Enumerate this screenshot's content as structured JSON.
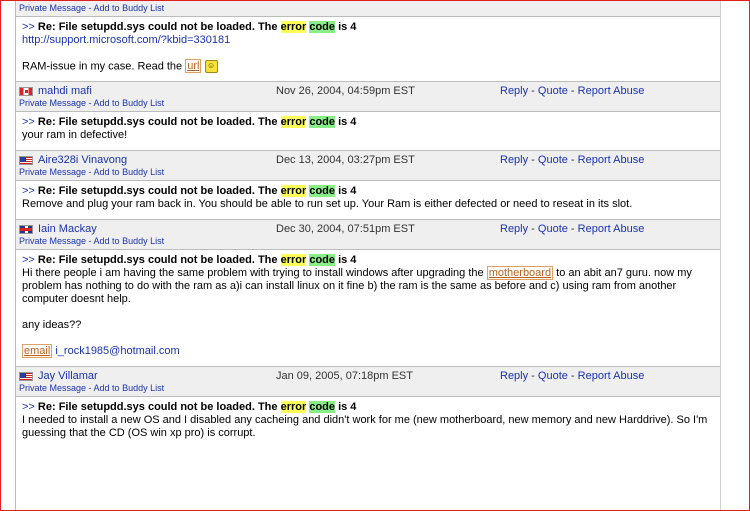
{
  "top_header": {
    "links": {
      "pm": "Private Message",
      "sep": " - ",
      "buddy": "Add to Buddy List"
    }
  },
  "posts": [
    {
      "has_header": false,
      "title_prefix": ">>",
      "title_lead": "Re: File setupdd.sys could not be loaded. The",
      "title_hl1": "error",
      "title_hl2": "code",
      "title_tail": "is 4",
      "link": "http://support.microsoft.com/?kbid=330181",
      "text_before_link": "RAM-issue in my case. Read the",
      "inline_link": "url",
      "smiley_icon": "smiley-icon"
    },
    {
      "author": "mahdi mafi",
      "flag": "canada-flag-icon",
      "date": "Nov 26, 2004, 04:59pm EST",
      "reply": "Reply",
      "quote": "Quote",
      "report": "Report Abuse",
      "pm": "Private Message",
      "buddy": "Add to Buddy List",
      "title_prefix": ">>",
      "title_lead": "Re: File setupdd.sys could not be loaded. The",
      "title_hl1": "error",
      "title_hl2": "code",
      "title_tail": "is 4",
      "text": "your ram in defective!"
    },
    {
      "author": "Aire328i Vinavong",
      "flag": "usa-flag-icon",
      "date": "Dec 13, 2004, 03:27pm EST",
      "reply": "Reply",
      "quote": "Quote",
      "report": "Report Abuse",
      "pm": "Private Message",
      "buddy": "Add to Buddy List",
      "title_prefix": ">>",
      "title_lead": "Re: File setupdd.sys could not be loaded. The",
      "title_hl1": "error",
      "title_hl2": "code",
      "title_tail": "is 4",
      "text": "Remove and plug your ram back in. You should be able to run set up. Your Ram is either defected or need to reseat in its slot."
    },
    {
      "author": "Iain Mackay",
      "flag": "uk-flag-icon",
      "date": "Dec 30, 2004, 07:51pm EST",
      "reply": "Reply",
      "quote": "Quote",
      "report": "Report Abuse",
      "pm": "Private Message",
      "buddy": "Add to Buddy List",
      "title_prefix": ">>",
      "title_lead": "Re: File setupdd.sys could not be loaded. The",
      "title_hl1": "error",
      "title_hl2": "code",
      "title_tail": "is 4",
      "text_a": "Hi there people i am having the same problem with trying to install windows after upgrading the",
      "text_link": "motherboard",
      "text_b": "to an abit an7 guru. now my problem has nothing to do with the ram as a)i can install linux on it fine b) the ram is the same as before and c) using ram from another computer doesnt help.",
      "text_q": "any ideas??",
      "email_label": "email",
      "email": "i_rock1985@hotmail.com"
    },
    {
      "author": "Jay Villamar",
      "flag": "usa-flag-icon",
      "date": "Jan 09, 2005, 07:18pm EST",
      "reply": "Reply",
      "quote": "Quote",
      "report": "Report Abuse",
      "pm": "Private Message",
      "buddy": "Add to Buddy List",
      "title_prefix": ">>",
      "title_lead": "Re: File setupdd.sys could not be loaded. The",
      "title_hl1": "error",
      "title_hl2": "code",
      "title_tail": "is 4",
      "text": "I needed to install a new OS and I disabled any cacheing and didn't work for me (new motherboard, new memory and new Harddrive). So I'm guessing that the CD (OS win xp pro) is corrupt."
    }
  ]
}
